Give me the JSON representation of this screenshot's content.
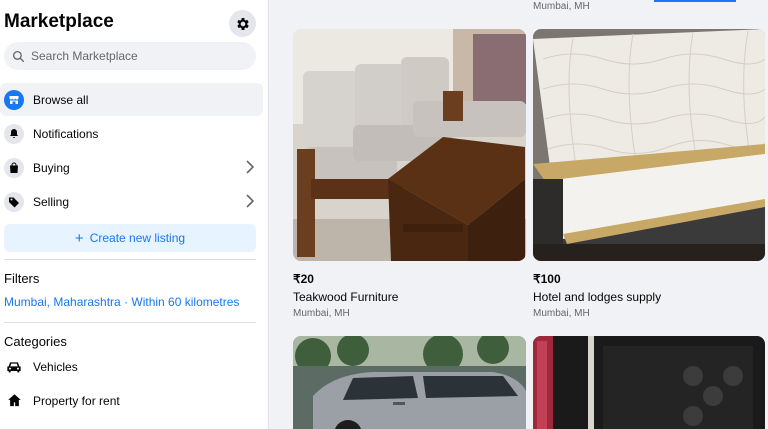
{
  "sidebar": {
    "title": "Marketplace",
    "search_placeholder": "Search Marketplace",
    "nav": [
      {
        "label": "Browse all"
      },
      {
        "label": "Notifications"
      },
      {
        "label": "Buying"
      },
      {
        "label": "Selling"
      }
    ],
    "create_label": "Create new listing",
    "filters_heading": "Filters",
    "location_filter": "Mumbai, Maharashtra · Within 60 kilometres",
    "categories_heading": "Categories",
    "categories": [
      {
        "label": "Vehicles"
      },
      {
        "label": "Property for rent"
      }
    ]
  },
  "main": {
    "top_location": "Mumbai, MH",
    "listings": [
      {
        "price": "₹20",
        "title": "Teakwood Furniture",
        "location": "Mumbai, MH"
      },
      {
        "price": "₹100",
        "title": "Hotel and lodges supply",
        "location": "Mumbai, MH"
      }
    ]
  },
  "colors": {
    "accent": "#1877f2",
    "accent_light": "#e7f3ff",
    "sidebar_bg": "#ffffff",
    "page_bg": "#f0f2f5"
  }
}
